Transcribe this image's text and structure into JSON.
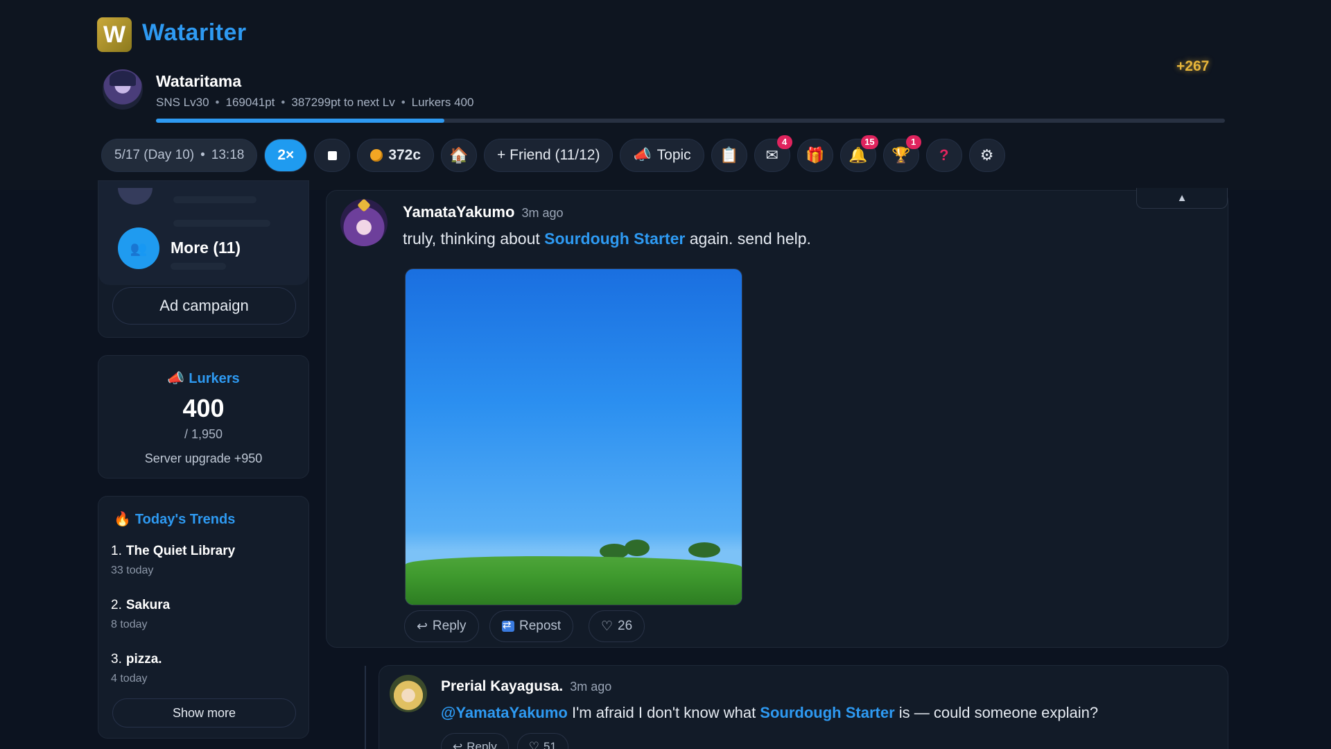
{
  "app": {
    "logo_letter": "W",
    "name": "Watariter",
    "brand_color": "#2e9af2"
  },
  "profile": {
    "username": "Wataritama",
    "level": "SNS Lv30",
    "points": "169041pt",
    "to_next": "387299pt to next Lv",
    "lurkers": "Lurkers 400",
    "score_gain": "+267",
    "xp_progress_percent": 27
  },
  "toolbar": {
    "date": "5/17 (Day 10)",
    "time": "13:18",
    "speed": "2×",
    "coins": "372c",
    "friend_button": "+ Friend (11/12)",
    "topic_button": "Topic",
    "mail_badge": "4",
    "notification_badge": "15",
    "trophy_badge": "1",
    "icons": [
      "home-icon",
      "clipboard-icon",
      "mail-icon",
      "gift-icon",
      "bell-icon",
      "trophy-icon",
      "help-icon",
      "gear-icon"
    ]
  },
  "sidebar": {
    "friends": {
      "more_label": "More (11)",
      "ad_button": "Ad campaign"
    },
    "lurkers": {
      "title": "Lurkers",
      "count": "400",
      "max": "/ 1,950",
      "upgrade": "Server upgrade +950"
    },
    "trends": {
      "title": "Today's Trends",
      "items": [
        {
          "rank": "1.",
          "name": "The Quiet Library",
          "count": "33 today"
        },
        {
          "rank": "2.",
          "name": "Sakura",
          "count": "8 today"
        },
        {
          "rank": "3.",
          "name": "pizza.",
          "count": "4 today"
        }
      ],
      "show_more": "Show more"
    }
  },
  "feed": {
    "scroll_top": "▲",
    "post": {
      "author": "YamataYakumo",
      "time": "3m ago",
      "text_before": "truly, thinking about ",
      "topic_link": "Sourdough Starter",
      "text_after": " again. send help.",
      "reply_label": "Reply",
      "repost_label": "Repost",
      "likes": "26"
    },
    "reply": {
      "author": "Prerial Kayagusa.",
      "time": "3m ago",
      "mention": "@YamataYakumo",
      "text_middle": " I'm afraid I don't know what ",
      "topic_link": "Sourdough Starter",
      "text_after": " is — could someone explain?",
      "reply_label": "Reply",
      "likes": "51"
    }
  }
}
